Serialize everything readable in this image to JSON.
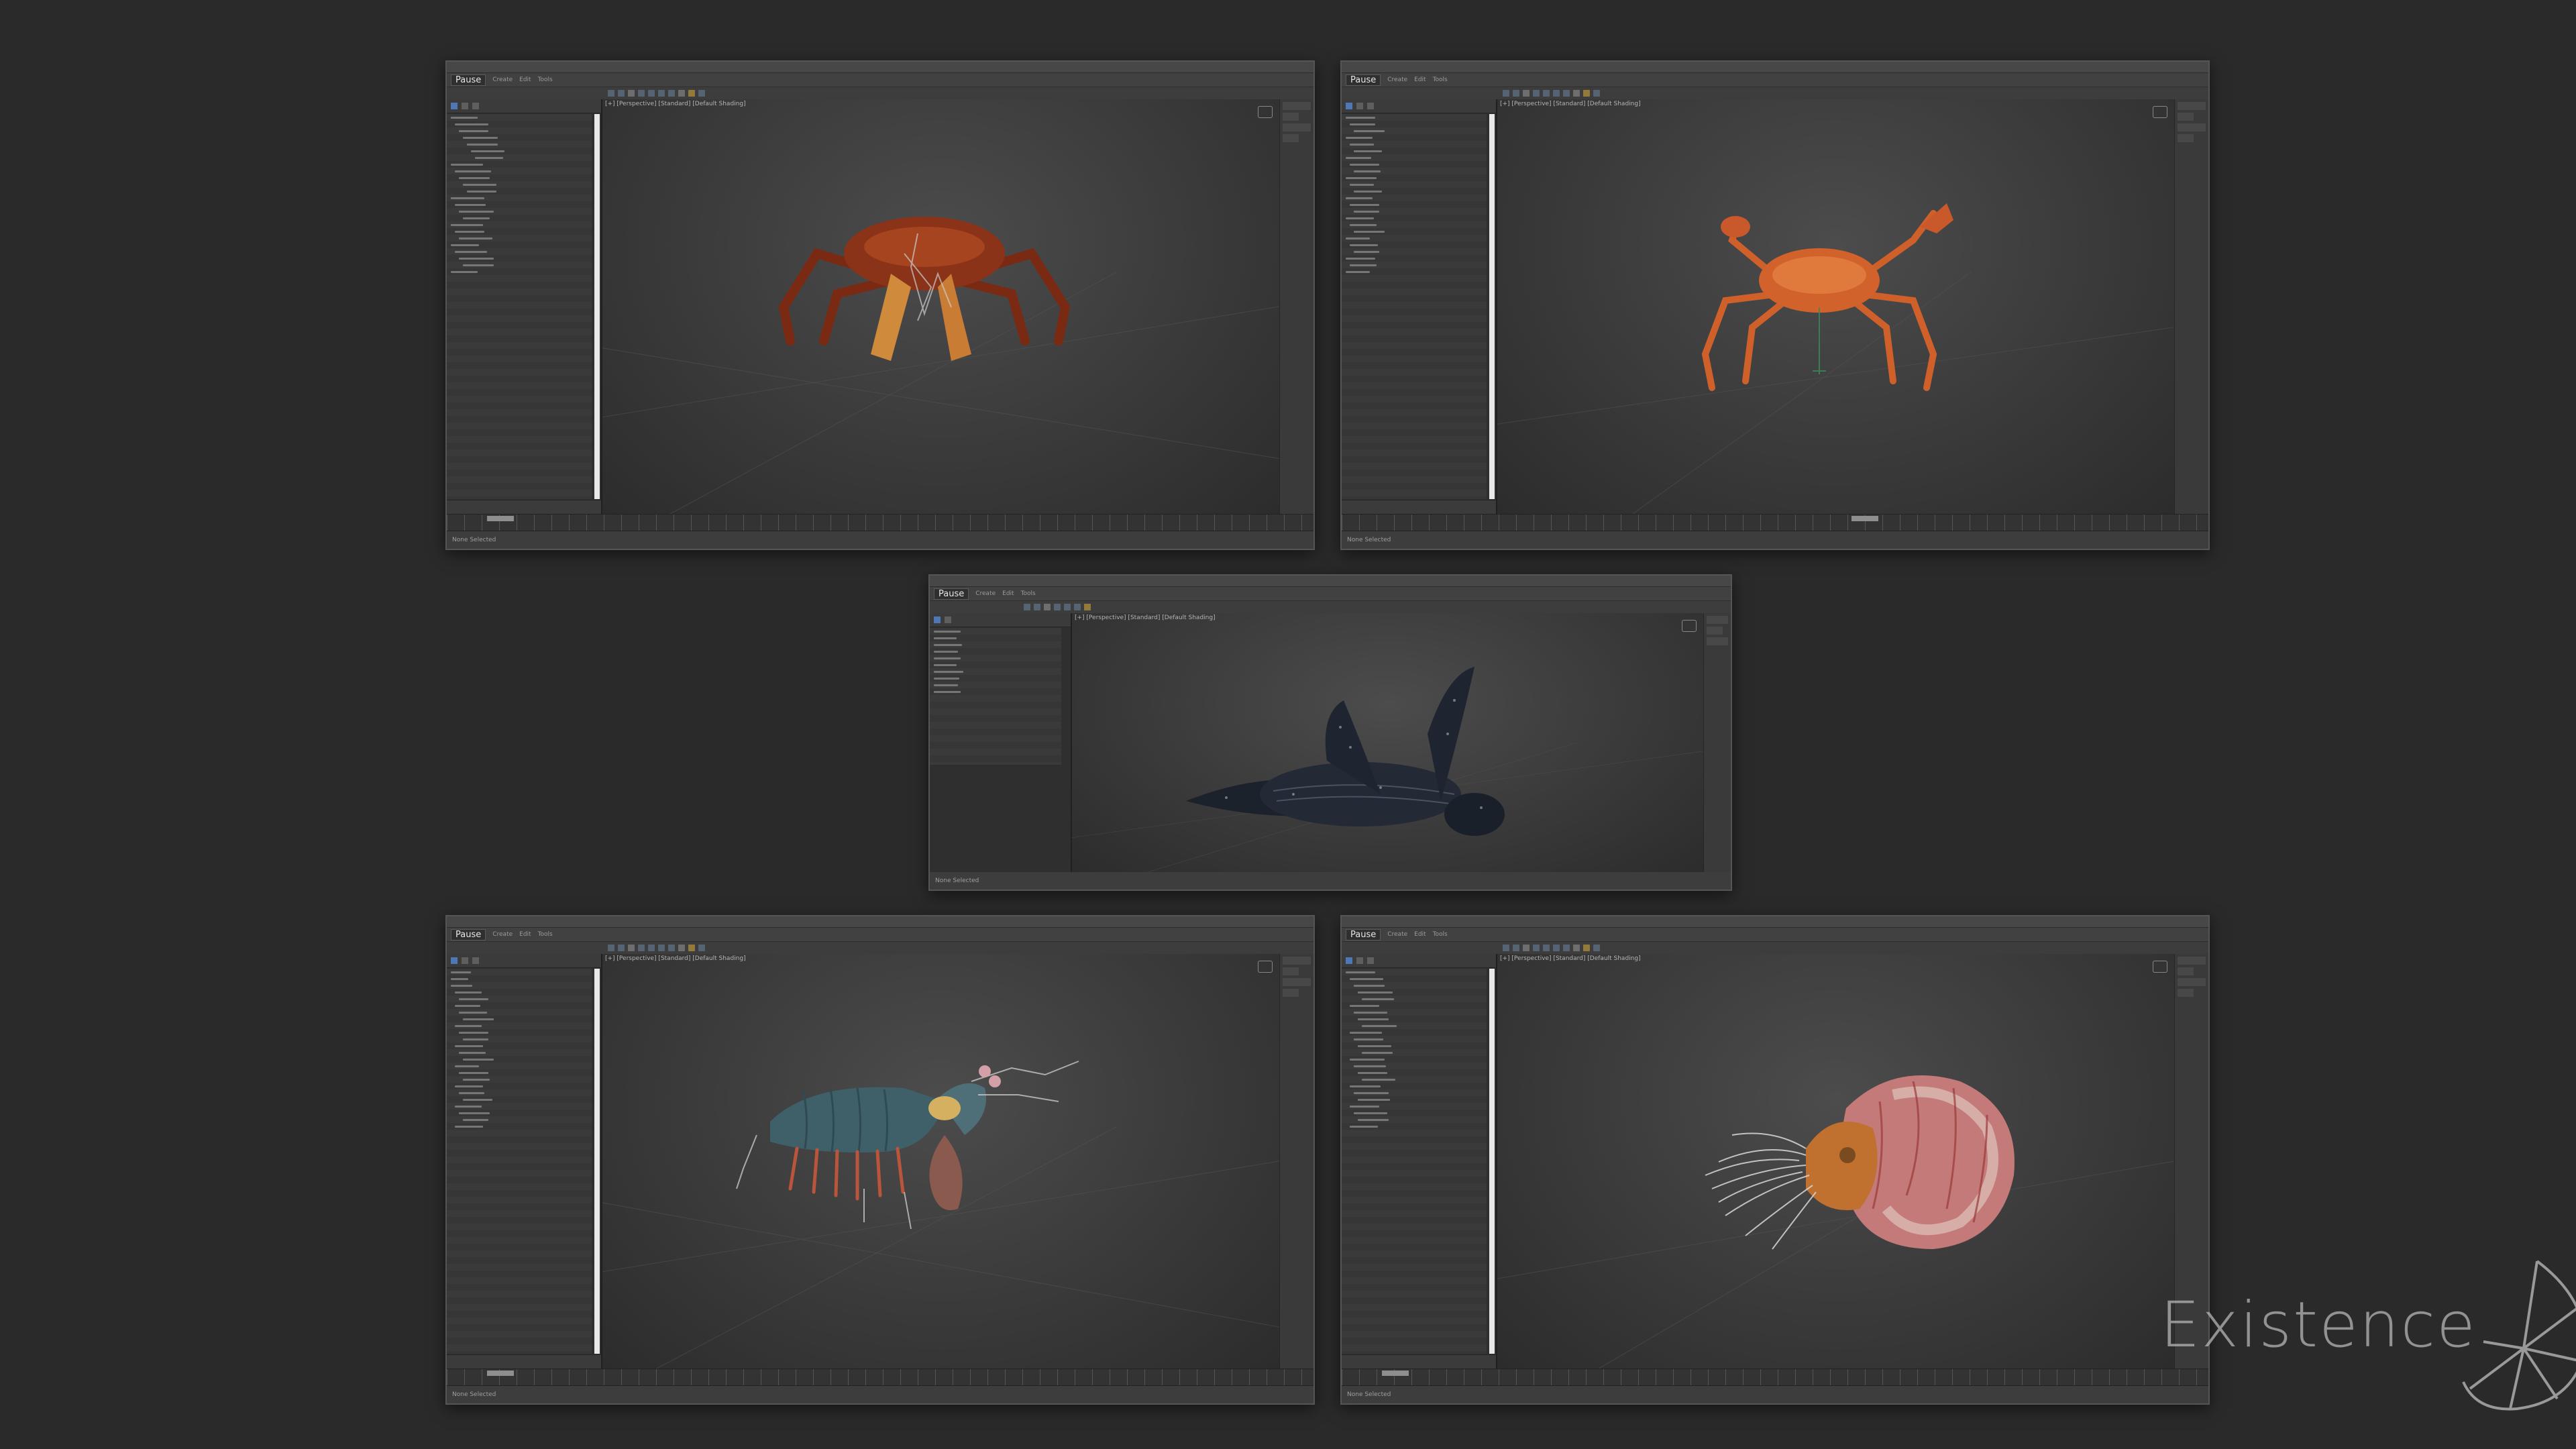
{
  "app": {
    "pause_label": "Pause",
    "menus": [
      "Create",
      "Edit",
      "Tools"
    ]
  },
  "windows": [
    {
      "id": "crab-1",
      "viewport_label": "[+] [Perspective] [Standard] [Default Shading]",
      "subject": "crab-icon",
      "status": "None Selected"
    },
    {
      "id": "crab-2",
      "viewport_label": "[+] [Perspective] [Standard] [Default Shading]",
      "subject": "crab-icon",
      "status": "None Selected"
    },
    {
      "id": "turtle",
      "viewport_label": "[+] [Perspective] [Standard] [Default Shading]",
      "subject": "turtle-icon",
      "status": "None Selected"
    },
    {
      "id": "mantis-shrimp",
      "viewport_label": "[+] [Perspective] [Standard] [Default Shading]",
      "subject": "shrimp-icon",
      "status": "None Selected"
    },
    {
      "id": "nautilus",
      "viewport_label": "[+] [Perspective] [Standard] [Default Shading]",
      "subject": "nautilus-icon",
      "status": "None Selected"
    }
  ],
  "watermark": {
    "text": "Existence"
  },
  "colors": {
    "background": "#2a2a2a",
    "crab_red": "#8a3318",
    "crab_orange": "#d0602a",
    "turtle": "#1e2430",
    "shrimp_body": "#3f6068",
    "nautilus_shell": "#c47a78"
  }
}
